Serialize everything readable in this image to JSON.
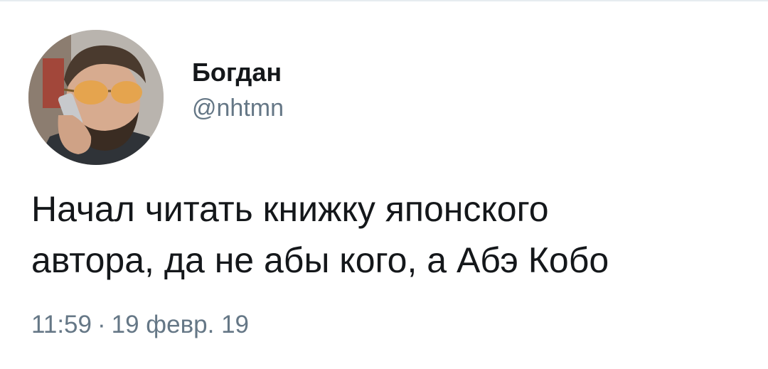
{
  "tweet": {
    "author": {
      "display_name": "Богдан",
      "handle": "@nhtmn",
      "avatar_icon": "user-avatar-photo"
    },
    "text_lines": [
      "Начал читать книжку японского",
      "автора, да не абы кого, а Абэ Кобо"
    ],
    "time": "11:59",
    "separator": "·",
    "date": "19 февр. 19"
  },
  "colors": {
    "text_primary": "#14171a",
    "text_secondary": "#657786",
    "background": "#ffffff"
  }
}
